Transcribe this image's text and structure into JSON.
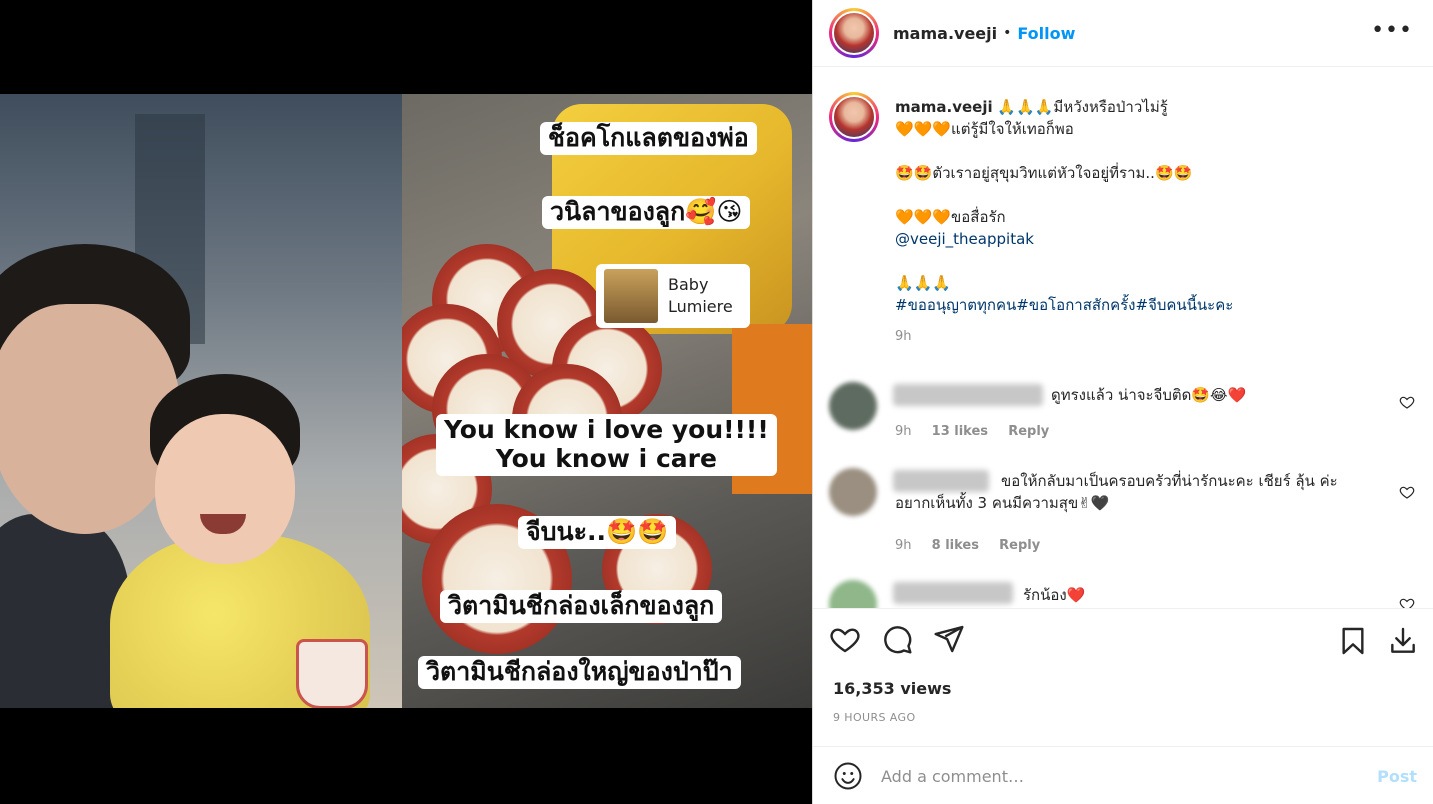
{
  "post": {
    "username": "mama.veeji",
    "follow_label": "Follow",
    "dot": "•",
    "more": "•••"
  },
  "video": {
    "captions": [
      "ช็อคโกแลตของพ่อ",
      "วนิลาของลูก🥰😘",
      "You know i love you!!!!\nYou know i care",
      "จีบนะ..🤩🤩",
      "วิตามินชีกล่องเล็กของลูก",
      "วิตามินชีกล่องใหญ่ของป่าป๊า"
    ],
    "music_title": "Baby",
    "music_artist": "Lumiere"
  },
  "caption": {
    "username": "mama.veeji",
    "line1": "🙏🙏🙏มีหวังหรือป่าวไม่รู้",
    "line2": "🧡🧡🧡แต่รู้มีใจให้เทอก็พอ",
    "line3": "🤩🤩ตัวเราอยู่สุขุมวิทแต่หัวใจอยู่ที่ราม..🤩🤩",
    "line4": "🧡🧡🧡ขอสื่อรัก",
    "mention": "@veeji_theappitak",
    "line5": "🙏🙏🙏",
    "hashtags": "#ขออนุญาตทุกคน#ขอโอกาสสักครั้ง#จีบคนนี้นะคะ",
    "time": "9h"
  },
  "comments": [
    {
      "text": "ดูทรงแล้ว น่าจะจีบติด🤩😂❤️",
      "time": "9h",
      "likes": "13 likes",
      "reply": "Reply",
      "avatar_color": "#5e6b60"
    },
    {
      "text": "ขอให้กลับมาเป็นครอบครัวที่น่ารักนะคะ เชียร์ ลุ้น ค่ะ อยากเห็นทั้ง 3 คนมีความสุข✌🖤",
      "time": "9h",
      "likes": "8 likes",
      "reply": "Reply",
      "avatar_color": "#9a8f80"
    },
    {
      "text": "รักน้อง❤️",
      "time": "",
      "likes": "",
      "reply": "",
      "avatar_color": "#8fb78a"
    }
  ],
  "footer": {
    "views": "16,353 views",
    "posted": "9 HOURS AGO",
    "add_comment_placeholder": "Add a comment…",
    "post_label": "Post"
  },
  "colors": {
    "link": "#00376b",
    "follow": "#0095f6",
    "muted": "#8e8e8e",
    "post_disabled": "#b2dffc"
  }
}
